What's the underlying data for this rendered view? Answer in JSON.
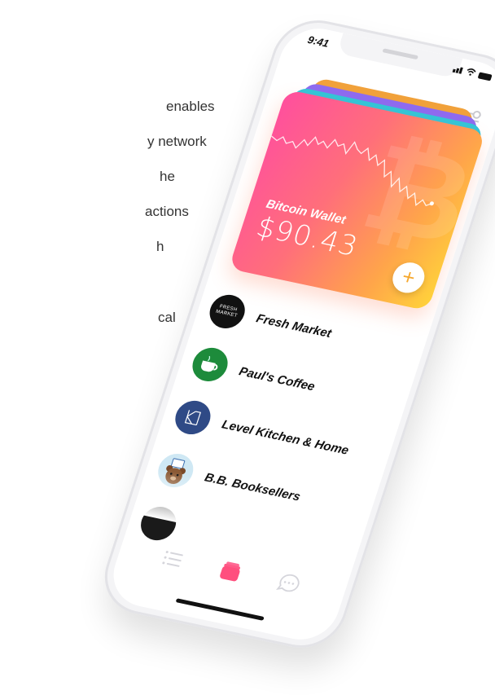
{
  "background_text": {
    "lines": [
      "enables",
      "y network",
      "he",
      "actions",
      "h",
      "cal"
    ]
  },
  "status_bar": {
    "time": "9:41"
  },
  "wallet_card": {
    "title": "Bitcoin Wallet",
    "balance": "$90.43",
    "add_symbol": "+",
    "watermark": "₿"
  },
  "merchants": [
    {
      "name": "Fresh Market",
      "avatar_text": "FRESH MARKET"
    },
    {
      "name": "Paul's Coffee"
    },
    {
      "name": "Level Kitchen & Home"
    },
    {
      "name": "B.B. Booksellers"
    }
  ],
  "tabbar": {
    "items": [
      "list-icon",
      "wallet-icon",
      "chat-icon"
    ],
    "active": "wallet-icon"
  },
  "colors": {
    "card_gradient": [
      "#ff4f9e",
      "#ffa54a",
      "#ffd33a"
    ],
    "accent": "#ff4f7e",
    "add_button_plus": "#f6a82e"
  }
}
